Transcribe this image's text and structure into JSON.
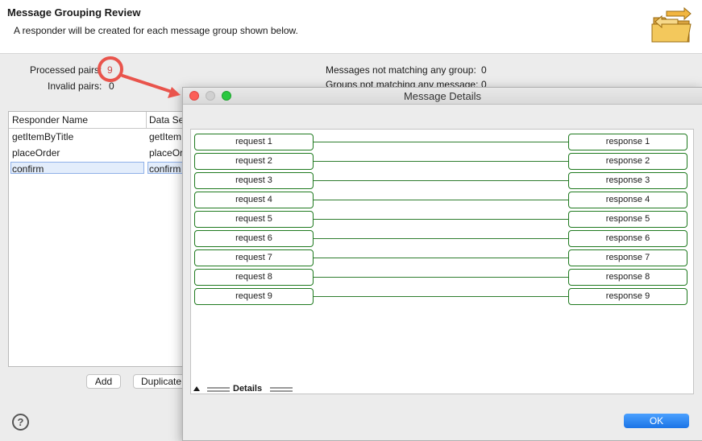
{
  "header": {
    "title": "Message Grouping Review",
    "description": "A responder will be created for each message group shown below."
  },
  "stats": {
    "processed_label": "Processed pairs:",
    "processed_value": "9",
    "invalid_label": "Invalid pairs:",
    "invalid_value": "0",
    "unmatched_messages_label": "Messages not matching any group:",
    "unmatched_messages_value": "0",
    "unmatched_groups_label": "Groups not matching any message:",
    "unmatched_groups_value": "0"
  },
  "table": {
    "columns": [
      "Responder Name",
      "Data Se"
    ],
    "rows": [
      [
        "getItemByTitle",
        "getItem"
      ],
      [
        "placeOrder",
        "placeOr"
      ],
      [
        "confirm",
        "confirm"
      ]
    ]
  },
  "buttons": {
    "add": "Add",
    "duplicate": "Duplicate"
  },
  "dialog": {
    "title": "Message Details",
    "requests": [
      "request 1",
      "request 2",
      "request 3",
      "request 4",
      "request 5",
      "request 6",
      "request 7",
      "request 8",
      "request 9"
    ],
    "responses": [
      "response 1",
      "response 2",
      "response 3",
      "response 4",
      "response 5",
      "response 6",
      "response 7",
      "response 8",
      "response 9"
    ],
    "details_label": "Details",
    "ok": "OK"
  },
  "colors": {
    "accent_green": "#1f7a1f",
    "annotation_red": "#e9544c",
    "ok_blue": "#1b74e6"
  }
}
